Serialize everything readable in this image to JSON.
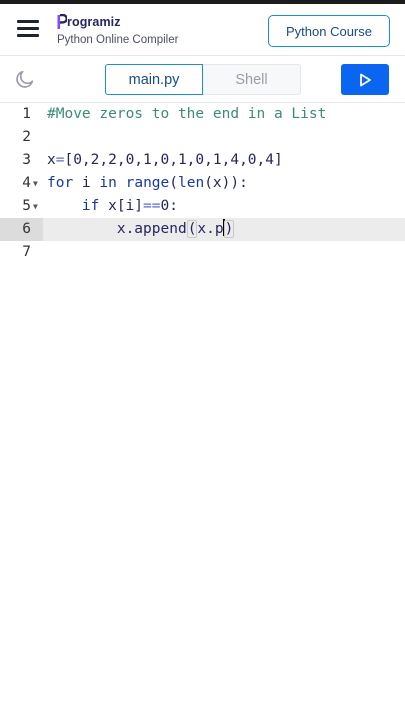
{
  "header": {
    "logo_text": "rogramiz",
    "subtitle": "Python Online Compiler",
    "course_button": "Python Course"
  },
  "toolbar": {
    "tabs": [
      {
        "label": "main.py",
        "active": true
      },
      {
        "label": "Shell",
        "active": false
      }
    ],
    "run_icon": "play-icon",
    "theme_icon": "moon-icon"
  },
  "editor": {
    "lines": [
      {
        "number": "1",
        "code": "#Move zeros to the end in a List"
      },
      {
        "number": "2",
        "code": ""
      },
      {
        "number": "3",
        "code": "x=[0,2,2,0,1,0,1,0,1,4,0,4]"
      },
      {
        "number": "4",
        "code": "for i in range(len(x)):"
      },
      {
        "number": "5",
        "code": "    if x[i]==0:"
      },
      {
        "number": "6",
        "code": "        x.append(x.p)"
      },
      {
        "number": "7",
        "code": ""
      }
    ],
    "active_line": 6
  },
  "colors": {
    "accent": "#1f8ec0",
    "run_button": "#0a66f0",
    "comment": "#3c8a7a",
    "keyword": "#1a37a0"
  }
}
